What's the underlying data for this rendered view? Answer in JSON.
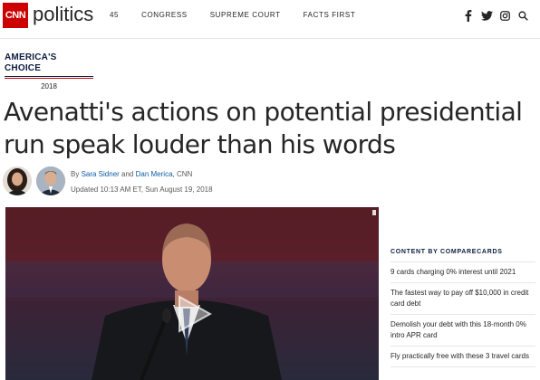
{
  "header": {
    "logo_text": "CNN",
    "section": "politics",
    "nav": [
      "45",
      "CONGRESS",
      "SUPREME COURT",
      "FACTS FIRST"
    ],
    "social_icons": [
      "facebook-icon",
      "twitter-icon",
      "instagram-icon",
      "search-icon"
    ]
  },
  "badge": {
    "title": "AMERICA'S CHOICE",
    "year": "2018"
  },
  "article": {
    "headline": "Avenatti's actions on potential presidential run speak louder than his words",
    "by_prefix": "By ",
    "author1": "Sara Sidner",
    "and": " and ",
    "author2": "Dan Merica",
    "source": ", CNN",
    "updated": "Updated 10:13 AM ET, Sun August 19, 2018"
  },
  "sidebar": {
    "title": "CONTENT BY COMPARECARDS",
    "items": [
      "9 cards charging 0% interest until 2021",
      "The fastest way to pay off $10,000 in credit card debt",
      "Demolish your debt with this 18-month 0% intro APR card",
      "Fly practically free with these 3 travel cards"
    ]
  },
  "colors": {
    "brand_red": "#cc0000",
    "link_blue": "#0c5ba8",
    "navy": "#0c1d3f"
  }
}
